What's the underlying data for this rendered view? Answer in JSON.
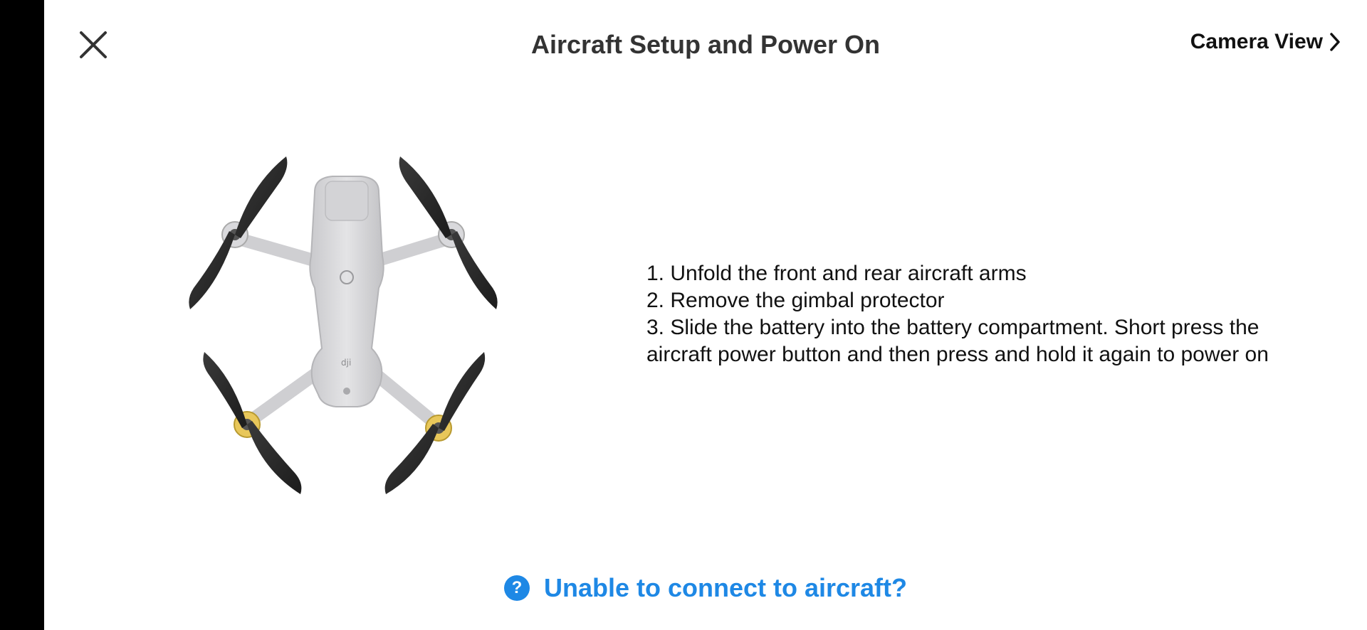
{
  "header": {
    "title": "Aircraft Setup and Power On",
    "camera_view_label": "Camera View",
    "close_icon": "close-icon",
    "chevron_icon": "chevron-right-icon"
  },
  "illustration": {
    "description_icon": "drone-top-view-illustration"
  },
  "instructions": {
    "steps": [
      "1. Unfold the front and rear aircraft arms",
      "2. Remove the gimbal protector",
      "3. Slide the battery into the battery compartment. Short press the",
      "aircraft power button and then press and hold it again to power on"
    ]
  },
  "footer": {
    "help_label": "Unable to connect to aircraft?",
    "help_icon": "question-icon",
    "help_icon_glyph": "?"
  },
  "colors": {
    "accent": "#1e88e5",
    "title": "#333333",
    "sidebar": "#000000"
  }
}
